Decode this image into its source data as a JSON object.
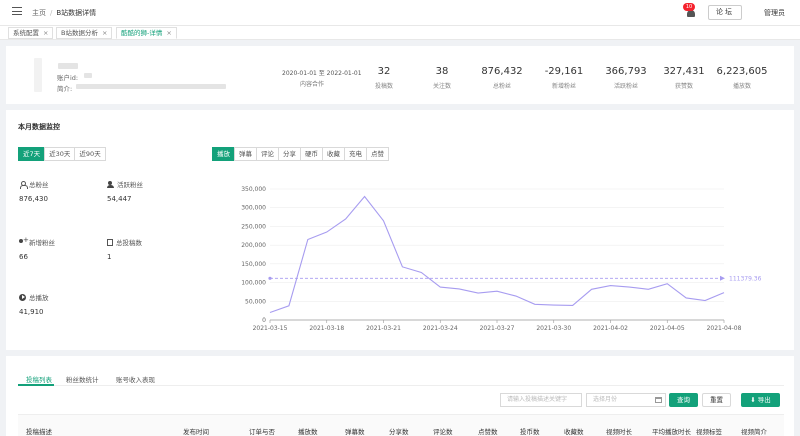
{
  "header": {
    "breadcrumb": [
      "主页",
      "B站数据详情"
    ],
    "notification_count": "10",
    "forum_label": "论坛",
    "user_label": "管理员"
  },
  "tabs": [
    {
      "label": "系统配置",
      "close": "×",
      "active": false
    },
    {
      "label": "B站数据分析",
      "close": "×",
      "active": false
    },
    {
      "label": "酷酷的狮-详情",
      "close": "×",
      "active": true
    }
  ],
  "account": {
    "account_id_label": "账户id:",
    "intro_label": "简介:"
  },
  "summary": {
    "date_range": "2020-01-01 至 2022-01-01",
    "date_label": "内容合作",
    "stats": [
      {
        "value": "32",
        "label": "投稿数"
      },
      {
        "value": "38",
        "label": "关注数"
      },
      {
        "value": "876,432",
        "label": "总粉丝"
      },
      {
        "value": "-29,161",
        "label": "新增粉丝"
      },
      {
        "value": "366,793",
        "label": "活跃粉丝"
      },
      {
        "value": "327,431",
        "label": "获赞数"
      },
      {
        "value": "6,223,605",
        "label": "播放数"
      }
    ]
  },
  "monitor": {
    "title": "本月数据监控",
    "ranges": [
      "近7天",
      "近30天",
      "近90天"
    ],
    "active_range": 0,
    "metric_tabs": [
      "播放",
      "弹幕",
      "评论",
      "分享",
      "硬币",
      "收藏",
      "充电",
      "点赞"
    ],
    "active_metric": 0,
    "metrics": [
      {
        "icon": "user-icon",
        "label": "总粉丝",
        "value": "876,430"
      },
      {
        "icon": "users-icon",
        "label": "活跃粉丝",
        "value": "54,447"
      },
      {
        "icon": "user-add-icon",
        "label": "新增粉丝",
        "value": "66"
      },
      {
        "icon": "document-icon",
        "label": "总投稿数",
        "value": "1"
      },
      {
        "icon": "play-circle-icon",
        "label": "总播放",
        "value": "41,910"
      }
    ]
  },
  "chart_data": {
    "type": "line",
    "x": [
      "2021-03-15",
      "2021-03-16",
      "2021-03-17",
      "2021-03-18",
      "2021-03-19",
      "2021-03-20",
      "2021-03-21",
      "2021-03-22",
      "2021-03-23",
      "2021-03-24",
      "2021-03-25",
      "2021-03-26",
      "2021-03-27",
      "2021-03-28",
      "2021-03-29",
      "2021-03-30",
      "2021-03-31",
      "2021-04-01",
      "2021-04-02",
      "2021-04-03",
      "2021-04-04",
      "2021-04-05",
      "2021-04-06",
      "2021-04-07",
      "2021-04-08"
    ],
    "x_tick_labels": [
      "2021-03-15",
      "2021-03-18",
      "2021-03-21",
      "2021-03-24",
      "2021-03-27",
      "2021-03-30",
      "2021-04-02",
      "2021-04-05",
      "2021-04-08"
    ],
    "series": [
      {
        "values": [
          20000,
          38000,
          215000,
          235000,
          270000,
          330000,
          265000,
          142000,
          127000,
          88000,
          83000,
          72000,
          77000,
          64000,
          42000,
          40000,
          39000,
          82000,
          92000,
          88000,
          82000,
          97000,
          59000,
          52000,
          73000
        ]
      }
    ],
    "average": 111379.36,
    "average_label": "111379.36",
    "ylim": [
      0,
      350000
    ],
    "y_ticks": [
      "0",
      "50,000",
      "100,000",
      "150,000",
      "200,000",
      "250,000",
      "300,000",
      "350,000"
    ],
    "grid": true,
    "color": "#a79cf0"
  },
  "bottom": {
    "tabs": [
      "投稿列表",
      "粉丝数统计",
      "账号收入表现"
    ],
    "active_tab": 0,
    "search_placeholder": "请输入投稿描述关键字",
    "month_placeholder": "选择月份",
    "query_label": "查询",
    "reset_label": "重置",
    "export_label": "导出",
    "columns": [
      "投稿描述",
      "发布时间",
      "订单与否",
      "播放数",
      "弹幕数",
      "分享数",
      "评论数",
      "点赞数",
      "投币数",
      "收藏数",
      "视频时长",
      "平均播放时长",
      "视频标签",
      "视频简介"
    ]
  },
  "colors": {
    "accent": "#13a17a",
    "line": "#a79cf0",
    "badge": "#f5222d"
  }
}
